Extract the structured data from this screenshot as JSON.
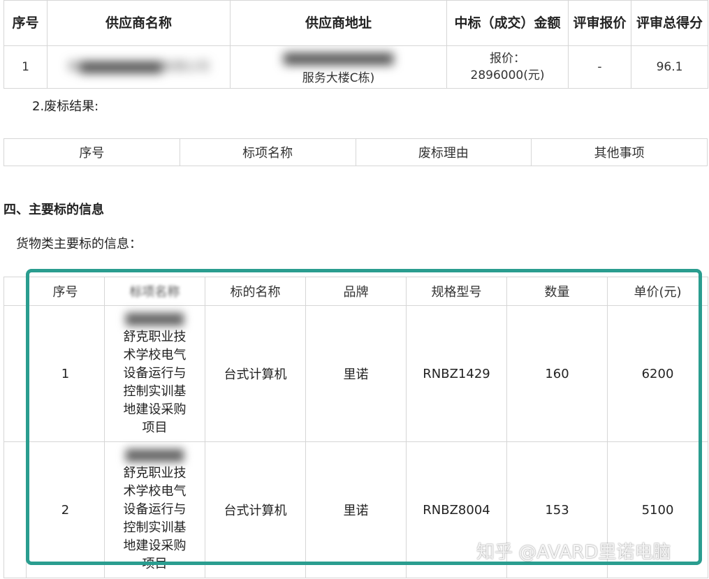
{
  "winning_table": {
    "headers": [
      "序号",
      "供应商名称",
      "供应商地址",
      "中标（成交）金额",
      "评审报价",
      "评审总得分"
    ],
    "row": {
      "index": "1",
      "supplier_name_blurred": "新▇▇▇▇▇▇▇▇▇有限公司",
      "address_blurred": "▇▇▇▇▇▇▇▇▇▇▇▇",
      "address_visible": "服务大楼C栋)",
      "amount": "报价：2896000(元)",
      "review_price": "-",
      "score": "96.1"
    }
  },
  "failed_label": "2.废标结果:",
  "failed_table": {
    "headers": [
      "序号",
      "标项名称",
      "废标理由",
      "其他事项"
    ]
  },
  "section_heading": "四、主要标的信息",
  "goods_label": "货物类主要标的信息：",
  "goods_table": {
    "headers": [
      "序号",
      "标项名称",
      "标的名称",
      "品牌",
      "规格型号",
      "数量",
      "单价(元)"
    ],
    "rows": [
      {
        "index": "1",
        "project_blurred": "▇▇▇▇▇▇",
        "project_lines": [
          "舒克职业技",
          "术学校电气",
          "设备运行与",
          "控制实训基",
          "地建设采购",
          "项目"
        ],
        "item": "台式计算机",
        "brand": "里诺",
        "model": "RNBZ1429",
        "qty": "160",
        "price": "6200"
      },
      {
        "index": "2",
        "project_blurred": "▇▇▇▇▇▇",
        "project_lines": [
          "舒克职业技",
          "术学校电气",
          "设备运行与",
          "控制实训基",
          "地建设采购",
          "项目"
        ],
        "item": "台式计算机",
        "brand": "里诺",
        "model": "RNBZ8004",
        "qty": "153",
        "price": "5100"
      }
    ]
  },
  "highlight_color": "#2a9d8f",
  "watermark": "知乎 @AVARD里诺电脑"
}
